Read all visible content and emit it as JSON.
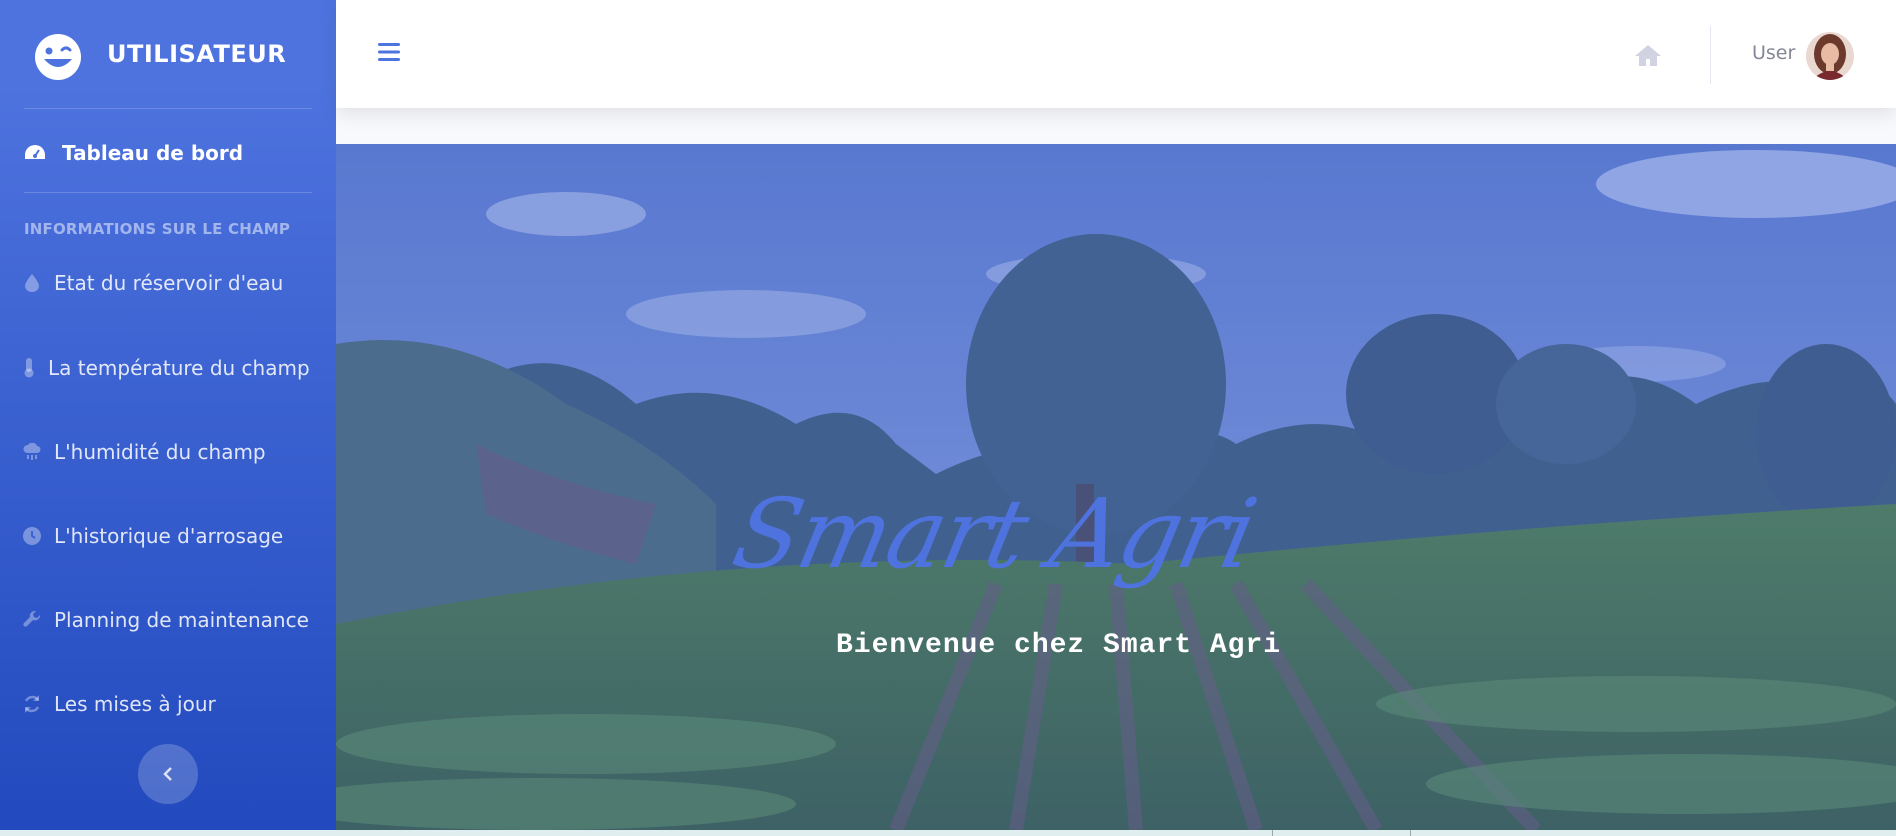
{
  "brand": {
    "title": "UTILISATEUR",
    "icon": "laugh-wink-icon"
  },
  "sidebar": {
    "dashboard_label": "Tableau de bord",
    "section_heading": "INFORMATIONS SUR LE CHAMP",
    "items": [
      {
        "label": "Etat du réservoir d'eau",
        "icon": "water-drop-icon"
      },
      {
        "label": "La température du champ",
        "icon": "thermometer-icon"
      },
      {
        "label": "L'humidité du champ",
        "icon": "cloud-rain-icon"
      },
      {
        "label": "L'historique d'arrosage",
        "icon": "clock-icon"
      },
      {
        "label": "Planning de maintenance",
        "icon": "wrench-icon"
      },
      {
        "label": "Les mises à jour",
        "icon": "sync-icon"
      }
    ]
  },
  "topbar": {
    "user_label": "User"
  },
  "hero": {
    "title": "Smart Agri",
    "subtitle": "Bienvenue chez Smart Agri"
  },
  "colors": {
    "primary": "#4e73df",
    "primary_dark": "#224abe",
    "muted": "#858796"
  }
}
